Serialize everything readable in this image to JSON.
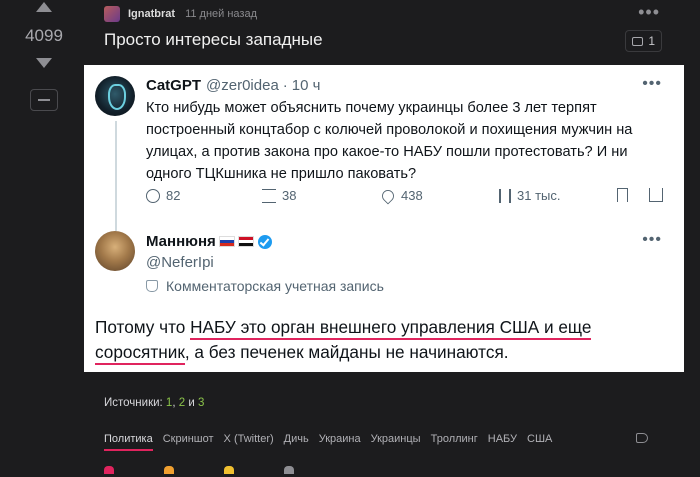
{
  "post": {
    "score": "4099",
    "author": "Ignatbrat",
    "time_ago": "11 дней назад",
    "title": "Просто интересы западные",
    "comments_count": "1"
  },
  "tweet1": {
    "name": "CatGPT",
    "handle": "@zer0idea",
    "time": "10 ч",
    "text": "Кто нибудь может объяснить почему украинцы более 3 лет терпят построенный концтабор с колючей проволокой и похищения мужчин на улицах, а против закона про какое-то НАБУ пошли протестовать? И ни одного ТЦКшника не пришло паковать?",
    "replies": "82",
    "retweets": "38",
    "likes": "438",
    "views": "31 тыс."
  },
  "tweet2": {
    "name": "Маннюня",
    "handle": "@NeferIpi",
    "label": "Комментаторская учетная запись",
    "text_part1": "Потому что ",
    "text_underlined1": "НАБУ это орган внешнего управления США и еще",
    "text_underlined2": "соросятник",
    "text_part2": ", а без печенек майданы не начинаются."
  },
  "sources": {
    "label": "Источники:",
    "links": [
      "1",
      "2",
      "3"
    ]
  },
  "tags": [
    "Политика",
    "Скриншот",
    "X (Twitter)",
    "Дичь",
    "Украина",
    "Украинцы",
    "Троллинг",
    "НАБУ",
    "США"
  ]
}
